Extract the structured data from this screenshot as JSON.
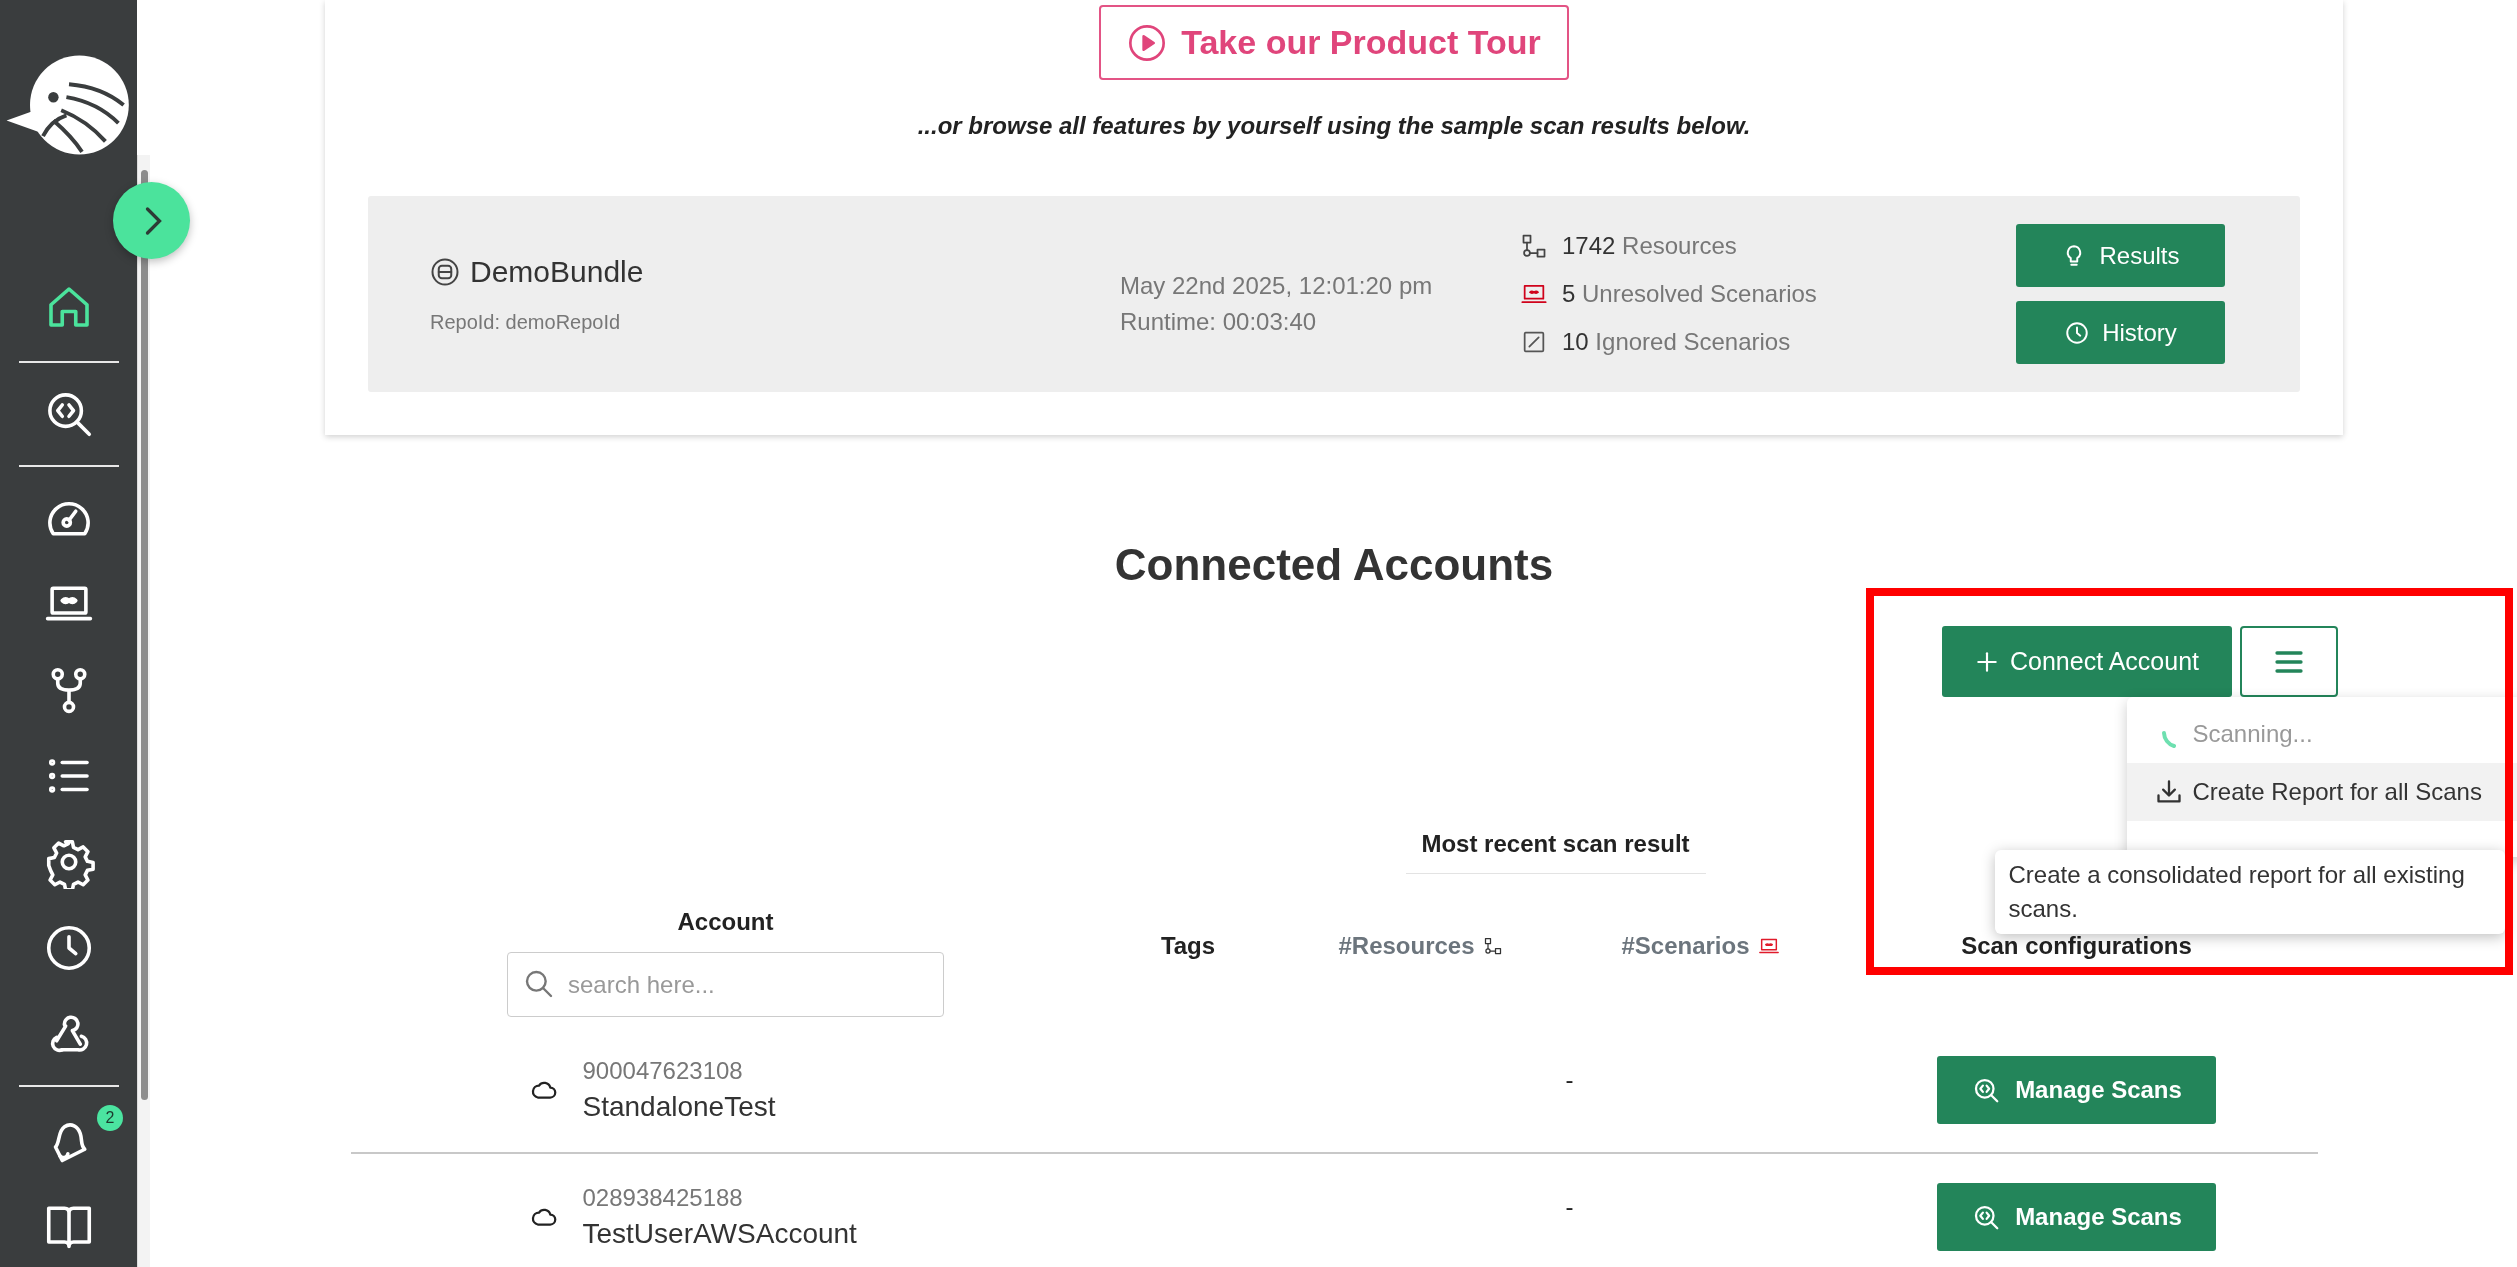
{
  "sidebar": {
    "groups": [
      {
        "items": [
          {
            "kind": "home",
            "selected": true
          }
        ]
      },
      {
        "items": [
          {
            "kind": "code-search",
            "selected": false
          }
        ]
      },
      {
        "items": [
          {
            "kind": "gauge",
            "selected": false
          },
          {
            "kind": "laptop",
            "selected": false
          },
          {
            "kind": "branch",
            "selected": false
          },
          {
            "kind": "list",
            "selected": false
          },
          {
            "kind": "gear",
            "selected": false
          },
          {
            "kind": "clock",
            "selected": false
          },
          {
            "kind": "webhook",
            "selected": false
          }
        ]
      },
      {
        "items": [
          {
            "kind": "bell",
            "selected": false,
            "badge": "2"
          },
          {
            "kind": "book",
            "selected": false
          }
        ]
      }
    ]
  },
  "product_tour_button": "Take our Product Tour",
  "subtitle": "...or browse all features by yourself using the sample scan results below.",
  "demo_bundle": {
    "name": "DemoBundle",
    "repo_id": "RepoId: demoRepoId",
    "date": "May 22nd 2025, 12:01:20 pm",
    "runtime": "Runtime: 00:03:40",
    "stats": [
      {
        "kind": "resources",
        "count": "1742",
        "label": "Resources"
      },
      {
        "kind": "unresolved",
        "count": "5",
        "label": "Unresolved Scenarios"
      },
      {
        "kind": "ignored",
        "count": "10",
        "label": "Ignored Scenarios"
      }
    ],
    "buttons": [
      {
        "kind": "results",
        "label": "Results"
      },
      {
        "kind": "history",
        "label": "History"
      }
    ]
  },
  "accounts": {
    "title": "Connected Accounts",
    "connect_button": "Connect Account",
    "menu": {
      "expanded": true,
      "items": [
        {
          "kind": "scanning",
          "label": "Scanning...",
          "disabled": true,
          "highlighted": false
        },
        {
          "kind": "report",
          "label": "Create Report for all Scans",
          "disabled": false,
          "highlighted": true
        }
      ]
    },
    "tooltip": "Create a consolidated report for all existing scans.",
    "highlight_frame": true,
    "table": {
      "group_header": "Most recent scan result",
      "columns": [
        {
          "kind": "account",
          "label": "Account"
        },
        {
          "kind": "tags",
          "label": "Tags"
        },
        {
          "kind": "resources",
          "label": "#Resources"
        },
        {
          "kind": "scenarios",
          "label": "#Scenarios"
        },
        {
          "kind": "config",
          "label": "Scan configurations"
        }
      ],
      "search": {
        "placeholder": "search here..."
      },
      "rows": [
        {
          "account_id": "900047623108",
          "name": "StandaloneTest",
          "result": "-",
          "action": "Manage Scans"
        },
        {
          "account_id": "028938425188",
          "name": "TestUserAWSAccount",
          "result": "-",
          "action": "Manage Scans"
        }
      ]
    }
  }
}
